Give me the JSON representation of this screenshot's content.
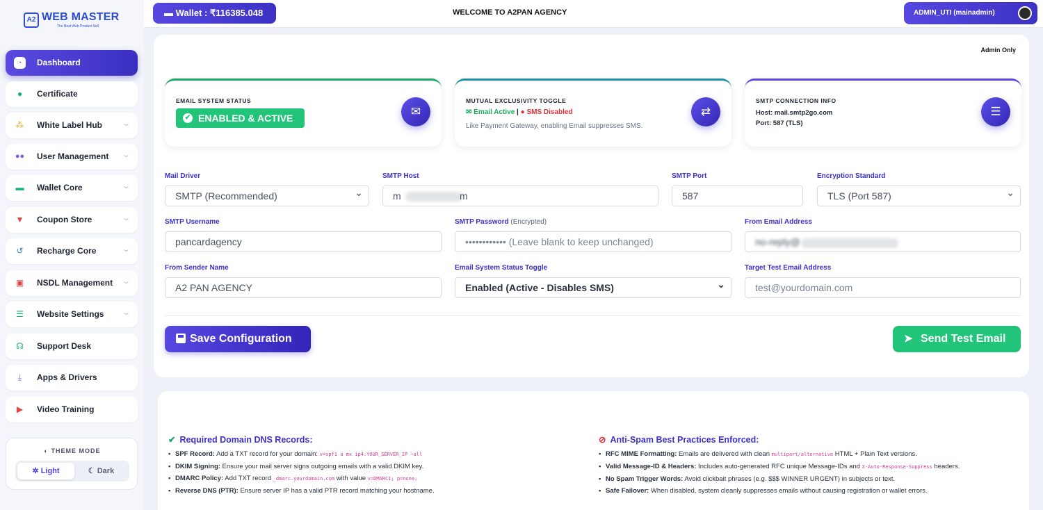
{
  "sidebar": {
    "logo": {
      "title": "WEB MASTER",
      "tagline": "The Best Web Product Sell",
      "mark": "A2"
    },
    "items": [
      {
        "label": "Dashboard",
        "icon": "dashboard-icon",
        "color": "#ffffff"
      },
      {
        "label": "Certificate",
        "icon": "certificate-icon",
        "color": "#16b27a"
      },
      {
        "label": "White Label Hub",
        "icon": "sitemap-icon",
        "color": "#f5a524"
      },
      {
        "label": "User Management",
        "icon": "users-icon",
        "color": "#7c5ce6"
      },
      {
        "label": "Wallet Core",
        "icon": "wallet-icon",
        "color": "#16b27a"
      },
      {
        "label": "Coupon Store",
        "icon": "cart-icon",
        "color": "#e64545"
      },
      {
        "label": "Recharge Core",
        "icon": "history-icon",
        "color": "#3b7ddd"
      },
      {
        "label": "NSDL Management",
        "icon": "id-card-icon",
        "color": "#e64545"
      },
      {
        "label": "Website Settings",
        "icon": "sliders-icon",
        "color": "#16b27a"
      },
      {
        "label": "Support Desk",
        "icon": "headset-icon",
        "color": "#16b27a"
      },
      {
        "label": "Apps & Drivers",
        "icon": "download-icon",
        "color": "#7c5ce6"
      },
      {
        "label": "Video Training",
        "icon": "video-icon",
        "color": "#e64545"
      }
    ],
    "theme": {
      "title": "THEME MODE",
      "light": "Light",
      "dark": "Dark",
      "selected": "Light"
    }
  },
  "topbar": {
    "wallet": "Wallet : ₹116385.048",
    "welcome": "WELCOME TO A2PAN AGENCY",
    "admin": "ADMIN_UTI (mainadmin)"
  },
  "main": {
    "admin_only": "Admin Only",
    "cards": {
      "email_status": {
        "title": "EMAIL SYSTEM STATUS",
        "badge": "ENABLED & ACTIVE",
        "icon": "mail-bulk-icon"
      },
      "exclusivity": {
        "title": "MUTUAL EXCLUSIVITY TOGGLE",
        "email_active": "Email Active",
        "sep": " | ",
        "sms_disabled": "SMS Disabled",
        "desc": "Like Payment Gateway, enabling Email suppresses SMS.",
        "icon": "exchange-icon"
      },
      "smtp_info": {
        "title": "SMTP CONNECTION INFO",
        "host": "Host: mail.smtp2go.com",
        "port": "Port: 587 (TLS)",
        "icon": "server-icon"
      }
    },
    "form": {
      "mail_driver": {
        "label": "Mail Driver",
        "value": "SMTP (Recommended)"
      },
      "smtp_host": {
        "label": "SMTP Host",
        "value_start": "m",
        "value_end": "m"
      },
      "smtp_port": {
        "label": "SMTP Port",
        "value": "587"
      },
      "encryption": {
        "label": "Encryption Standard",
        "value": "TLS (Port 587)"
      },
      "smtp_username": {
        "label": "SMTP Username",
        "value": "pancardagency"
      },
      "smtp_password": {
        "label": "SMTP Password",
        "label_sub": " (Encrypted)",
        "placeholder": "•••••••••••• (Leave blank to keep unchanged)"
      },
      "from_email": {
        "label": "From Email Address",
        "value_start": "no-reply@"
      },
      "sender_name": {
        "label": "From Sender Name",
        "value": "A2 PAN AGENCY"
      },
      "status_toggle": {
        "label": "Email System Status Toggle",
        "value": "Enabled (Active - Disables SMS)"
      },
      "test_email": {
        "label": "Target Test Email Address",
        "placeholder": "test@yourdomain.com"
      }
    },
    "buttons": {
      "save": "Save Configuration",
      "test": "Send Test Email"
    }
  },
  "info": {
    "dns": {
      "title": "Required Domain DNS Records:",
      "items": [
        {
          "bold": "SPF Record:",
          "text": " Add a TXT record for your domain: ",
          "code": "v=spf1 a mx ip4:YOUR_SERVER_IP ~all",
          "text2": ""
        },
        {
          "bold": "DKIM Signing:",
          "text": " Ensure your mail server signs outgoing emails with a valid DKIM key.",
          "code": "",
          "text2": ""
        },
        {
          "bold": "DMARC Policy:",
          "text": " Add TXT record ",
          "code": "_dmarc.yourdomain.com",
          "text2": " with value ",
          "code2": "v=DMARC1; p=none;"
        },
        {
          "bold": "Reverse DNS (PTR):",
          "text": " Ensure server IP has a valid PTR record matching your hostname.",
          "code": "",
          "text2": ""
        }
      ]
    },
    "spam": {
      "title": "Anti-Spam Best Practices Enforced:",
      "items": [
        {
          "bold": "RFC MIME Formatting:",
          "text": " Emails are delivered with clean ",
          "code": "multipart/alternative",
          "text2": " HTML + Plain Text versions."
        },
        {
          "bold": "Valid Message-ID & Headers:",
          "text": " Includes auto-generated RFC unique Message-IDs and ",
          "code": "X-Auto-Response-Suppress",
          "text2": " headers."
        },
        {
          "bold": "No Spam Trigger Words:",
          "text": " Avoid clickbait phrases (e.g. $$$ WINNER URGENT) in subjects or text.",
          "code": "",
          "text2": ""
        },
        {
          "bold": "Safe Failover:",
          "text": " When disabled, system cleanly suppresses emails without causing registration or wallet errors.",
          "code": "",
          "text2": ""
        }
      ]
    }
  }
}
